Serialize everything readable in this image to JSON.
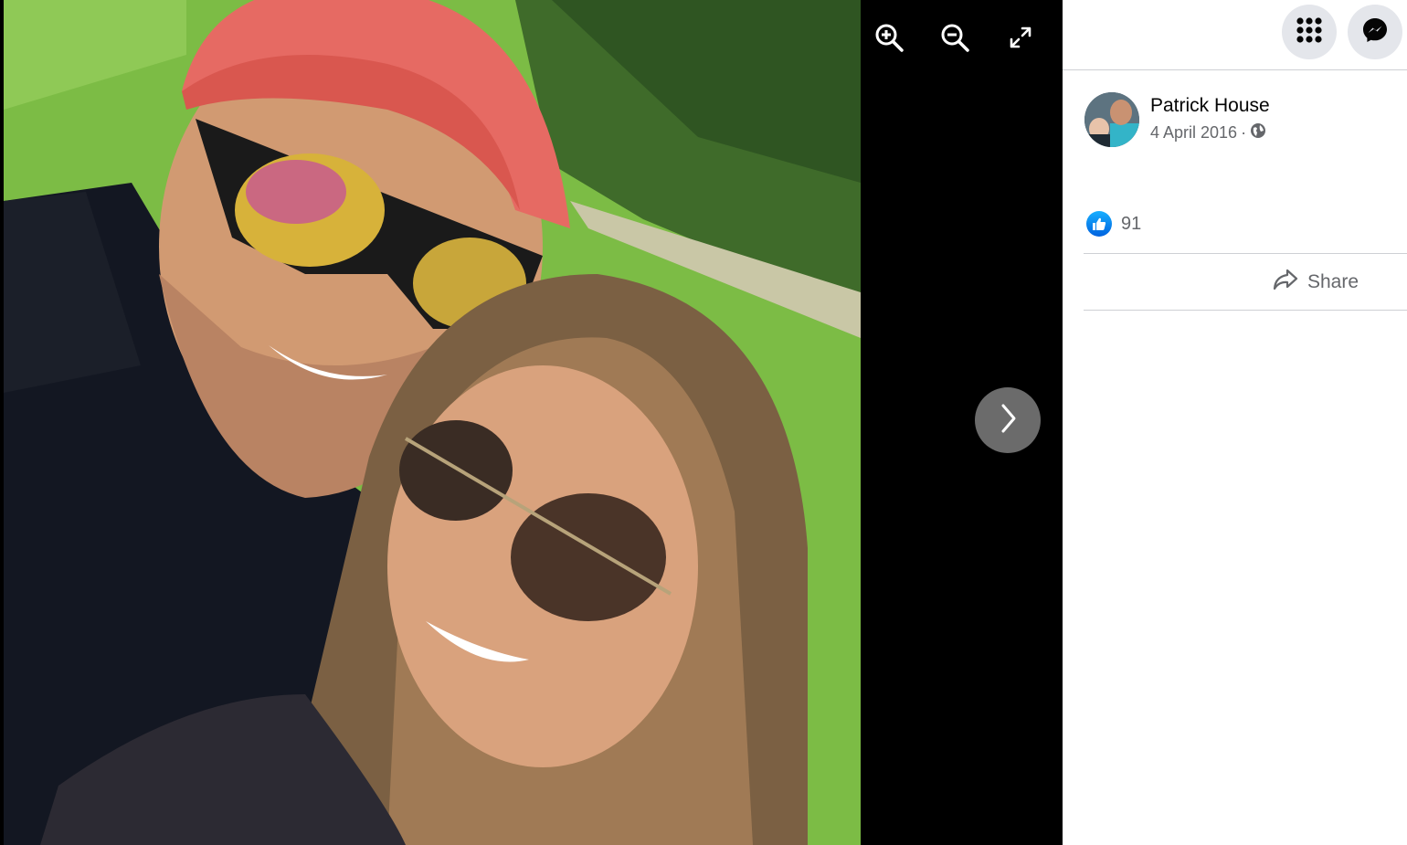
{
  "viewer": {
    "tools": [
      {
        "icon": "zoom-in-icon"
      },
      {
        "icon": "zoom-out-icon"
      },
      {
        "icon": "fullscreen-icon"
      }
    ],
    "next_icon": "chevron-right-icon"
  },
  "topbar": {
    "menu_icon": "grid-menu-icon",
    "messenger_icon": "messenger-icon"
  },
  "post": {
    "author": "Patrick House",
    "date": "4 April 2016",
    "separator": "·",
    "privacy_icon": "globe-icon",
    "reactions": {
      "icon": "like-icon",
      "count": "91"
    },
    "share_label": "Share"
  },
  "colors": {
    "like_blue": "#0866ff",
    "muted_text": "#65676b",
    "button_bg": "#e4e6eb"
  }
}
